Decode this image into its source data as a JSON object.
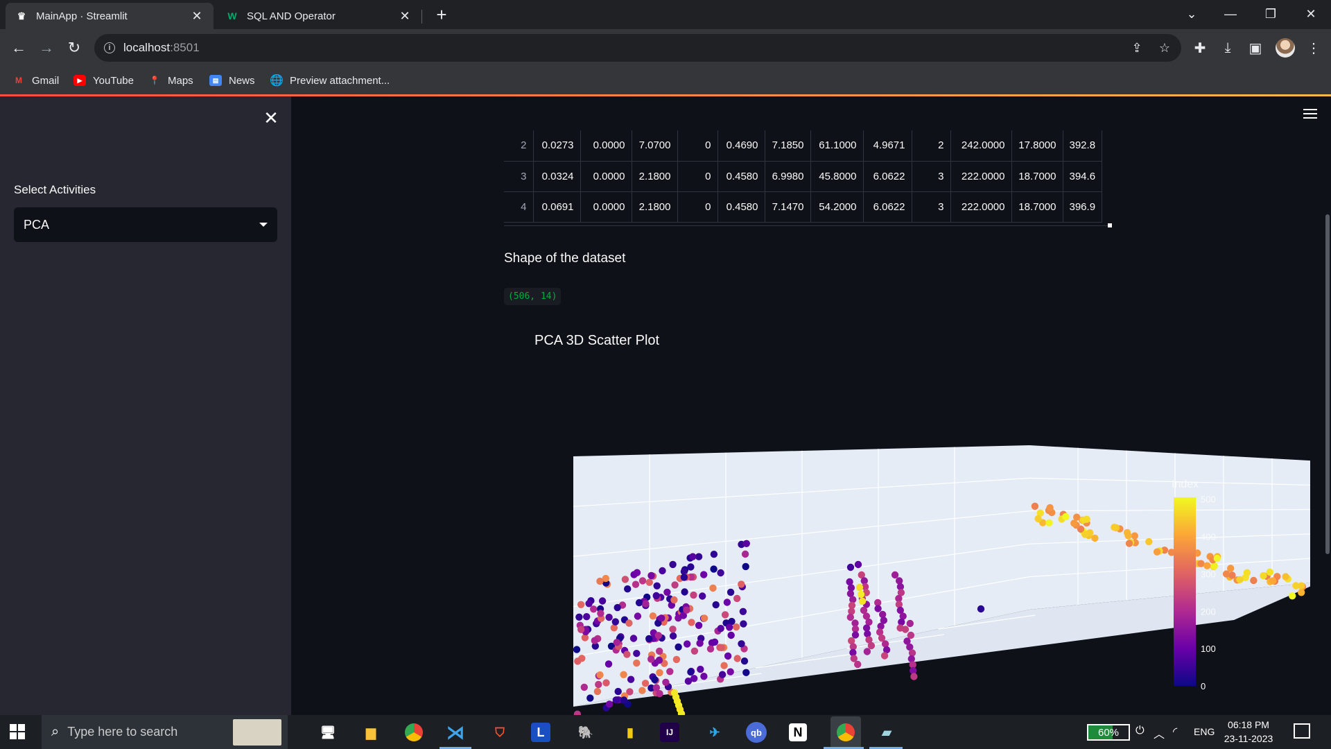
{
  "browser": {
    "tabs": [
      {
        "title": "MainApp · Streamlit",
        "favicon": "streamlit-crown-icon",
        "active": true
      },
      {
        "title": "SQL AND Operator",
        "favicon": "w3schools-icon",
        "active": false
      }
    ],
    "url_host": "localhost",
    "url_port": ":8501",
    "bookmarks": [
      {
        "label": "Gmail",
        "icon": "gmail-icon"
      },
      {
        "label": "YouTube",
        "icon": "youtube-icon"
      },
      {
        "label": "Maps",
        "icon": "maps-icon"
      },
      {
        "label": "News",
        "icon": "news-icon"
      },
      {
        "label": "Preview attachment...",
        "icon": "globe-icon"
      }
    ]
  },
  "sidebar": {
    "select_label": "Select Activities",
    "select_value": "PCA"
  },
  "dataframe": {
    "rows": [
      [
        "2",
        "0.0273",
        "0.0000",
        "7.0700",
        "0",
        "0.4690",
        "7.1850",
        "61.1000",
        "4.9671",
        "2",
        "242.0000",
        "17.8000",
        "392.8"
      ],
      [
        "3",
        "0.0324",
        "0.0000",
        "2.1800",
        "0",
        "0.4580",
        "6.9980",
        "45.8000",
        "6.0622",
        "3",
        "222.0000",
        "18.7000",
        "394.6"
      ],
      [
        "4",
        "0.0691",
        "0.0000",
        "2.1800",
        "0",
        "0.4580",
        "7.1470",
        "54.2000",
        "6.0622",
        "3",
        "222.0000",
        "18.7000",
        "396.9"
      ]
    ]
  },
  "shape_heading": "Shape of the dataset",
  "shape_value": "(506, 14)",
  "plot_title": "PCA 3D Scatter Plot",
  "chart_data": {
    "type": "scatter",
    "title": "PCA 3D Scatter Plot",
    "colorbar": {
      "title": "Index",
      "ticks": [
        "500",
        "400",
        "300",
        "200",
        "100",
        "0"
      ],
      "range": [
        0,
        505
      ],
      "colorscale": "plasma"
    },
    "axis_tick_visible": "200",
    "background": "#e5ecf6",
    "clusters": [
      {
        "label": "purple-orange cluster (index 0-350)",
        "index_range": [
          0,
          350
        ]
      },
      {
        "label": "vertical purple columns (index 100-250)",
        "index_range": [
          100,
          250
        ]
      },
      {
        "label": "yellow-orange tail (index 350-505)",
        "index_range": [
          350,
          505
        ]
      }
    ]
  },
  "taskbar": {
    "search_placeholder": "Type here to search",
    "battery": "60%",
    "language": "ENG",
    "time": "06:18 PM",
    "date": "23-11-2023"
  },
  "colors": {
    "app_bg": "#0e1117",
    "sidebar_bg": "#262730",
    "accent_red": "#ff4b4b",
    "code_green": "#09ab3b"
  }
}
